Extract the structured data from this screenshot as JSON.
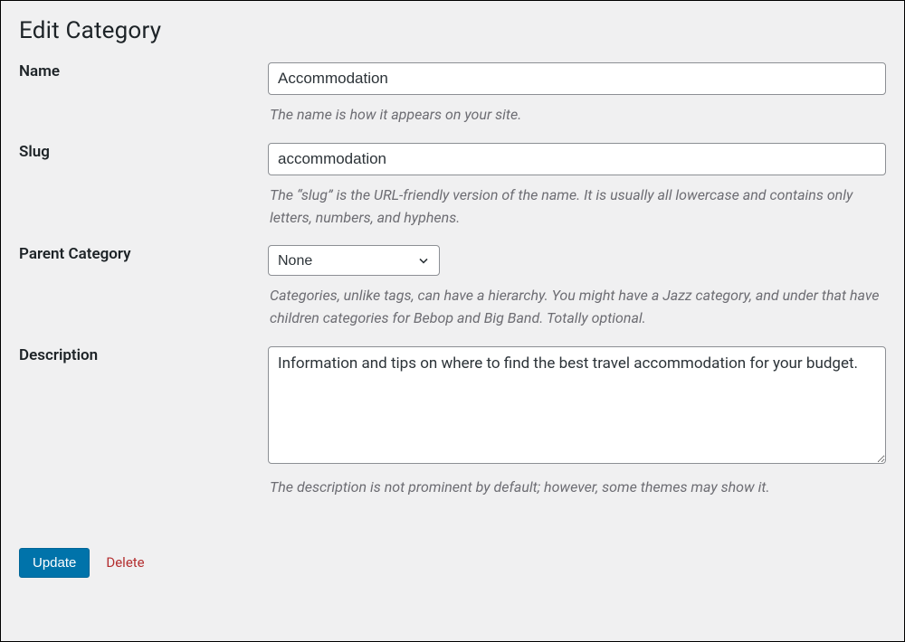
{
  "page": {
    "title": "Edit Category"
  },
  "fields": {
    "name": {
      "label": "Name",
      "value": "Accommodation",
      "help": "The name is how it appears on your site."
    },
    "slug": {
      "label": "Slug",
      "value": "accommodation",
      "help": "The “slug” is the URL-friendly version of the name. It is usually all lowercase and contains only letters, numbers, and hyphens."
    },
    "parent": {
      "label": "Parent Category",
      "selected": "None",
      "help": "Categories, unlike tags, can have a hierarchy. You might have a Jazz category, and under that have children categories for Bebop and Big Band. Totally optional."
    },
    "description": {
      "label": "Description",
      "value": "Information and tips on where to find the best travel accommodation for your budget.",
      "help": "The description is not prominent by default; however, some themes may show it."
    }
  },
  "actions": {
    "update": "Update",
    "delete": "Delete"
  }
}
